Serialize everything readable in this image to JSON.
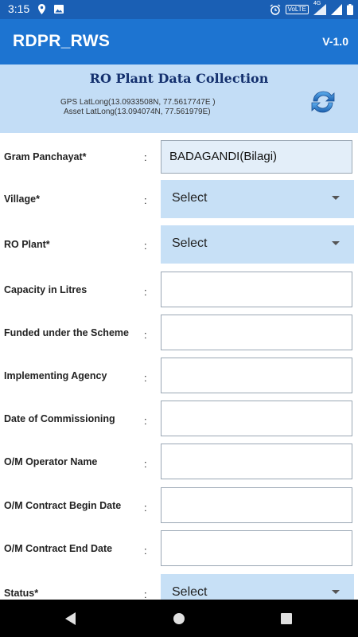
{
  "status_bar": {
    "time": "3:15",
    "volte": "VoLTE",
    "network": "4G",
    "icons": [
      "location-icon",
      "image-icon",
      "alarm-icon",
      "wifi-icon",
      "signal-icon",
      "battery-icon"
    ]
  },
  "app_bar": {
    "title": "RDPR_RWS",
    "version": "V-1.0"
  },
  "header": {
    "title": "RO Plant Data Collection",
    "gps": "GPS LatLong(13.0933508N, 77.5617747E )",
    "asset": "Asset LatLong(13.094074N, 77.561979E)",
    "refresh_icon": "refresh-icon"
  },
  "form": {
    "fields": [
      {
        "label": "Gram Panchayat*",
        "colon": ":",
        "value": "BADAGANDI(Bilagi)"
      },
      {
        "label": "Village*",
        "colon": ":",
        "value": "Select"
      },
      {
        "label": "RO Plant*",
        "colon": ":",
        "value": "Select"
      },
      {
        "label": "Capacity in Litres",
        "colon": ":",
        "value": ""
      },
      {
        "label": "Funded under the Scheme",
        "colon": ":",
        "value": ""
      },
      {
        "label": "Implementing Agency",
        "colon": ":",
        "value": ""
      },
      {
        "label": "Date of Commissioning",
        "colon": ":",
        "value": ""
      },
      {
        "label": "O/M Operator Name",
        "colon": ":",
        "value": ""
      },
      {
        "label": "O/M Contract Begin Date",
        "colon": ":",
        "value": ""
      },
      {
        "label": "O/M Contract End Date",
        "colon": ":",
        "value": ""
      },
      {
        "label": "Status*",
        "colon": ":",
        "value": "Select"
      }
    ]
  },
  "colors": {
    "status_bar": "#1a5fb4",
    "app_bar": "#1d74d1",
    "header_bg": "#c3ddf6",
    "select_bg": "#c7e0f6",
    "header_title": "#14306e"
  }
}
